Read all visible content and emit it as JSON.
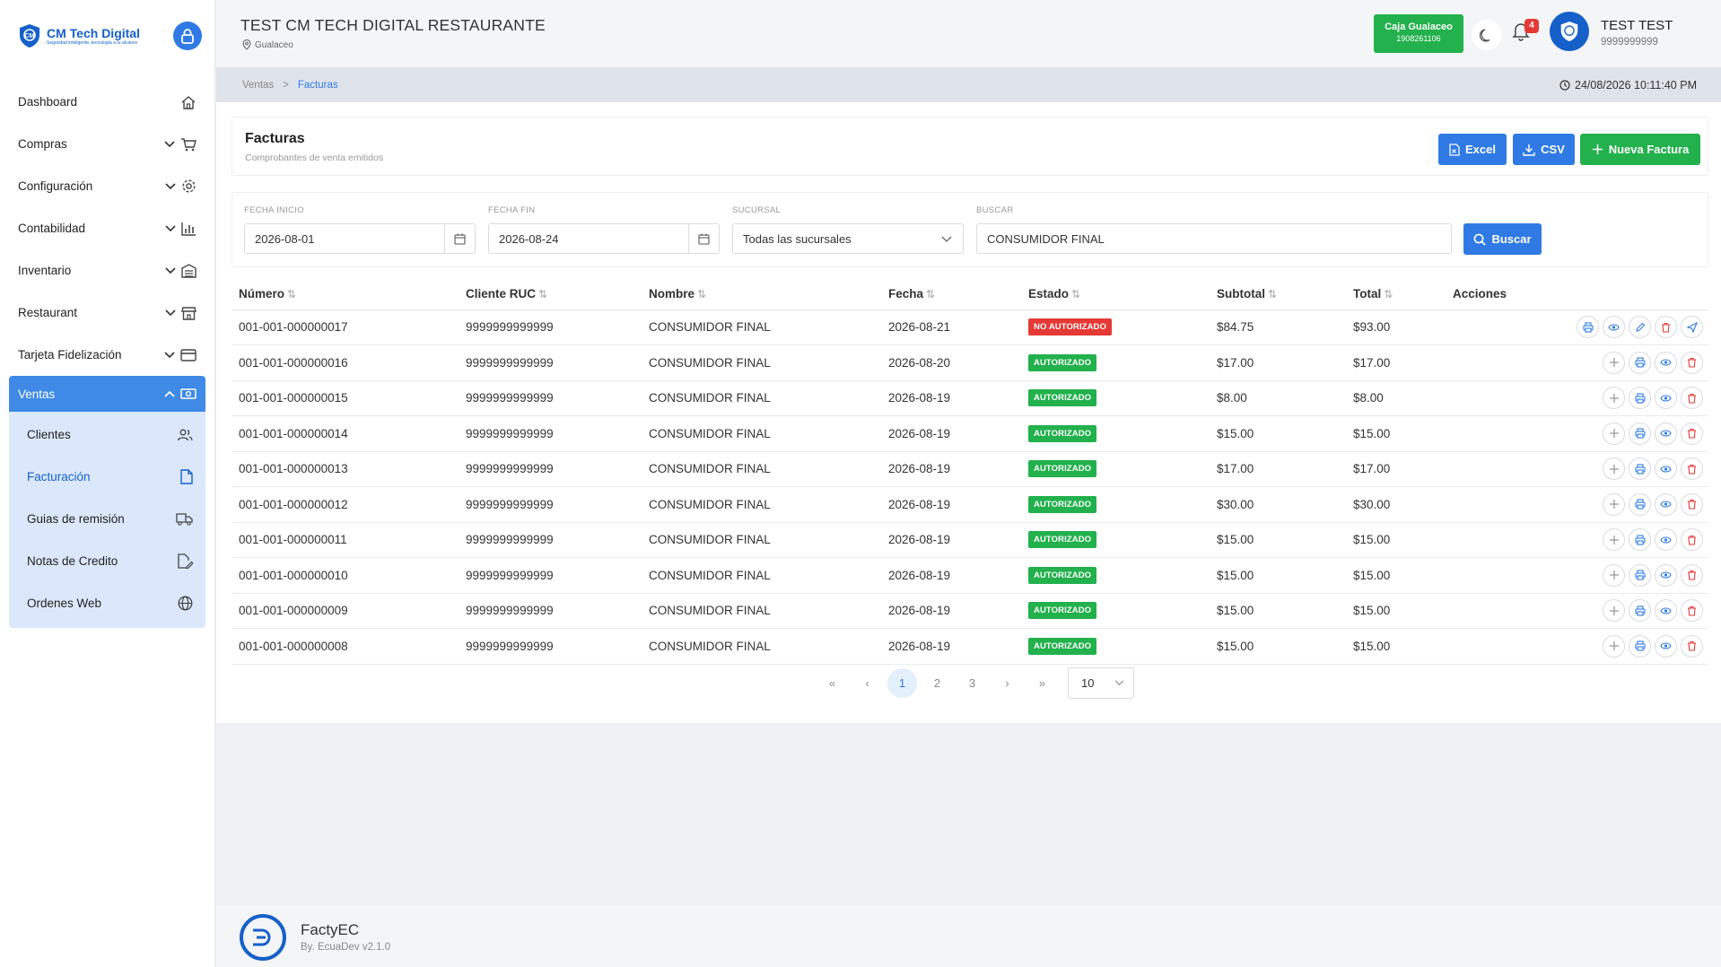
{
  "brand": {
    "name": "CM Tech Digital",
    "tagline": "Seguridad inteligente, tecnología a tu alcance"
  },
  "sidebar": {
    "items": [
      {
        "label": "Dashboard"
      },
      {
        "label": "Compras"
      },
      {
        "label": "Configuración"
      },
      {
        "label": "Contabilidad"
      },
      {
        "label": "Inventario"
      },
      {
        "label": "Restaurant"
      },
      {
        "label": "Tarjeta Fidelización"
      },
      {
        "label": "Ventas"
      }
    ],
    "submenu": [
      {
        "label": "Clientes"
      },
      {
        "label": "Facturación"
      },
      {
        "label": "Guias de remisión"
      },
      {
        "label": "Notas de Credito"
      },
      {
        "label": "Ordenes Web"
      }
    ]
  },
  "header": {
    "title": "TEST CM TECH DIGITAL RESTAURANTE",
    "location": "Gualaceo",
    "caja_label": "Caja Gualaceo",
    "caja_code": "1908261106",
    "notifications": "4",
    "user_name": "TEST TEST",
    "user_id": "9999999999"
  },
  "breadcrumb": {
    "parent": "Ventas",
    "separator": ">",
    "current": "Facturas",
    "datetime": "24/08/2026 10:11:40 PM"
  },
  "page": {
    "title": "Facturas",
    "subtitle": "Comprobantes de venta emitidos",
    "btn_excel": "Excel",
    "btn_csv": "CSV",
    "btn_new": "Nueva Factura"
  },
  "filters": {
    "fecha_inicio_label": "FECHA INICIO",
    "fecha_inicio": "2026-08-01",
    "fecha_fin_label": "FECHA FIN",
    "fecha_fin": "2026-08-24",
    "sucursal_label": "SUCURSAL",
    "sucursal": "Todas las sucursales",
    "buscar_label": "BUSCAR",
    "buscar": "CONSUMIDOR FINAL",
    "btn_buscar": "Buscar"
  },
  "table": {
    "columns": [
      "Número",
      "Cliente RUC",
      "Nombre",
      "Fecha",
      "Estado",
      "Subtotal",
      "Total",
      "Acciones"
    ],
    "rows": [
      {
        "numero": "001-001-000000017",
        "ruc": "9999999999999",
        "nombre": "CONSUMIDOR FINAL",
        "fecha": "2026-08-21",
        "estado": "NO AUTORIZADO",
        "subtotal": "$84.75",
        "total": "$93.00"
      },
      {
        "numero": "001-001-000000016",
        "ruc": "9999999999999",
        "nombre": "CONSUMIDOR FINAL",
        "fecha": "2026-08-20",
        "estado": "AUTORIZADO",
        "subtotal": "$17.00",
        "total": "$17.00"
      },
      {
        "numero": "001-001-000000015",
        "ruc": "9999999999999",
        "nombre": "CONSUMIDOR FINAL",
        "fecha": "2026-08-19",
        "estado": "AUTORIZADO",
        "subtotal": "$8.00",
        "total": "$8.00"
      },
      {
        "numero": "001-001-000000014",
        "ruc": "9999999999999",
        "nombre": "CONSUMIDOR FINAL",
        "fecha": "2026-08-19",
        "estado": "AUTORIZADO",
        "subtotal": "$15.00",
        "total": "$15.00"
      },
      {
        "numero": "001-001-000000013",
        "ruc": "9999999999999",
        "nombre": "CONSUMIDOR FINAL",
        "fecha": "2026-08-19",
        "estado": "AUTORIZADO",
        "subtotal": "$17.00",
        "total": "$17.00"
      },
      {
        "numero": "001-001-000000012",
        "ruc": "9999999999999",
        "nombre": "CONSUMIDOR FINAL",
        "fecha": "2026-08-19",
        "estado": "AUTORIZADO",
        "subtotal": "$30.00",
        "total": "$30.00"
      },
      {
        "numero": "001-001-000000011",
        "ruc": "9999999999999",
        "nombre": "CONSUMIDOR FINAL",
        "fecha": "2026-08-19",
        "estado": "AUTORIZADO",
        "subtotal": "$15.00",
        "total": "$15.00"
      },
      {
        "numero": "001-001-000000010",
        "ruc": "9999999999999",
        "nombre": "CONSUMIDOR FINAL",
        "fecha": "2026-08-19",
        "estado": "AUTORIZADO",
        "subtotal": "$15.00",
        "total": "$15.00"
      },
      {
        "numero": "001-001-000000009",
        "ruc": "9999999999999",
        "nombre": "CONSUMIDOR FINAL",
        "fecha": "2026-08-19",
        "estado": "AUTORIZADO",
        "subtotal": "$15.00",
        "total": "$15.00"
      },
      {
        "numero": "001-001-000000008",
        "ruc": "9999999999999",
        "nombre": "CONSUMIDOR FINAL",
        "fecha": "2026-08-19",
        "estado": "AUTORIZADO",
        "subtotal": "$15.00",
        "total": "$15.00"
      }
    ]
  },
  "pagination": {
    "pages": [
      "1",
      "2",
      "3"
    ],
    "current": "1",
    "page_size": "10"
  },
  "footer": {
    "name": "FactyEC",
    "version": "By. EcuaDev v2.1.0"
  },
  "colors": {
    "primary": "#2f7ae5",
    "success": "#22b14c",
    "danger": "#e53935",
    "sidebar_sub_bg": "#dbe8fb"
  }
}
